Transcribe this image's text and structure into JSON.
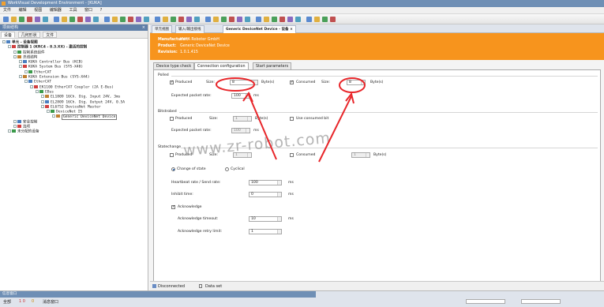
{
  "app": {
    "title": "WorkVisual Development Environment - [KUKA]"
  },
  "menu": [
    "文件",
    "编辑",
    "视图",
    "编辑器",
    "工具",
    "窗口",
    "?"
  ],
  "left_panel": {
    "title": "项目结构",
    "tabs": [
      "设备",
      "几何形状",
      "文件"
    ],
    "tree": [
      {
        "label": "单元 - 设备视图",
        "depth": 0,
        "bold": true
      },
      {
        "label": "控制器 1 (KRC4 - 8.3.XX) - 激活的控制",
        "depth": 1,
        "bold": true
      },
      {
        "label": "控制系统组件",
        "depth": 2
      },
      {
        "label": "总线结构",
        "depth": 2
      },
      {
        "label": "KUKA Controller Bus (KCB)",
        "depth": 3,
        "mono": true
      },
      {
        "label": "KUKA System Bus (SYS-X48)",
        "depth": 3,
        "mono": true
      },
      {
        "label": "EtherCAT",
        "depth": 4,
        "mono": true
      },
      {
        "label": "KUKA Extension Bus (SYS-X44)",
        "depth": 3,
        "mono": true
      },
      {
        "label": "EtherCAT",
        "depth": 4,
        "mono": true
      },
      {
        "label": "EK1100 EtherCAT Coupler (2A E-Bus)",
        "depth": 5,
        "mono": true
      },
      {
        "label": "EBus",
        "depth": 6,
        "mono": true
      },
      {
        "label": "EL1809 16Ch. Dig. Input 24V, 3ms",
        "depth": 7,
        "mono": true
      },
      {
        "label": "EL2809 16Ch. Dig. Output 24V, 0.5A",
        "depth": 7,
        "mono": true
      },
      {
        "label": "EL6752 DeviceNet Master",
        "depth": 7,
        "mono": true
      },
      {
        "label": "DeviceNet IS",
        "depth": 8,
        "mono": true
      },
      {
        "label": "Generic DeviceNet Device",
        "depth": 9,
        "mono": true,
        "selected": true
      },
      {
        "label": "安全控制",
        "depth": 2
      },
      {
        "label": "选项",
        "depth": 2
      },
      {
        "label": "未分配的设备",
        "depth": 1
      }
    ]
  },
  "doc_tabs": [
    "单元视图",
    "输入/输出接线",
    "Generic DeviceNet Device - 设备"
  ],
  "header": {
    "manufacturer_label": "Manufacturer:",
    "manufacturer": "KUKA Roboter GmbH",
    "product_label": "Product:",
    "product": "Generic DeviceNet Device",
    "revision_label": "Revision:",
    "revision": "1.0.1.415"
  },
  "config_tabs": [
    "Device type check",
    "Connection configuration",
    "Start parameters"
  ],
  "polled": {
    "title": "Polled",
    "produced_label": "Produced",
    "produced_checked": true,
    "size_label": "Size:",
    "produced_size": "8",
    "produced_unit": "Byte(s)",
    "consumed_label": "Consumed",
    "consumed_checked": true,
    "consumed_size": "8",
    "consumed_unit": "Byte(s)",
    "rate_label": "Expected packet rate:",
    "rate": "100",
    "rate_unit": "ms"
  },
  "bitstrobed": {
    "title": "Bitstrobed",
    "produced_label": "Produced",
    "size_label": "Size:",
    "produced_size": "1",
    "produced_unit": "Byte(s)",
    "consumed_label": "Use consumed bit",
    "rate_label": "Expected packet rate:",
    "rate": "100",
    "rate_unit": "ms"
  },
  "state_change": {
    "title": "Statechange",
    "produced_label": "Produced",
    "size_label": "Size:",
    "produced_size": "1",
    "consumed_label": "Consumed",
    "consumed_size": "1",
    "consumed_unit": "Byte(s)",
    "mode_change_label": "Change of state",
    "mode_cyclic_label": "Cyclical",
    "heartbeat_label": "Heartbeat rate / Send rate:",
    "heartbeat": "100",
    "heartbeat_unit": "ms",
    "inhibit_label": "Inhibit time:",
    "inhibit": "0",
    "inhibit_unit": "ms",
    "ack_label": "Acknowledge",
    "ack_checked": true,
    "ack_timeout_label": "Acknowledge timeout:",
    "ack_timeout": "10",
    "ack_timeout_unit": "ms",
    "ack_retry_label": "Acknowledge retry limit:",
    "ack_retry": "1"
  },
  "buttons": {
    "ok": "OK",
    "cancel": "Cancel",
    "apply": "Apply"
  },
  "status": {
    "disconnected": "Disconnected",
    "dataset": "Data set"
  },
  "bottom_panel": {
    "title": "信息窗口",
    "tabs": [
      "全部",
      "1 0",
      "0",
      "消息窗口"
    ]
  },
  "watermark": "www.zr-robot.com",
  "colors": {
    "header_orange": "#f7941d",
    "annotation_red": "#e8262a"
  }
}
